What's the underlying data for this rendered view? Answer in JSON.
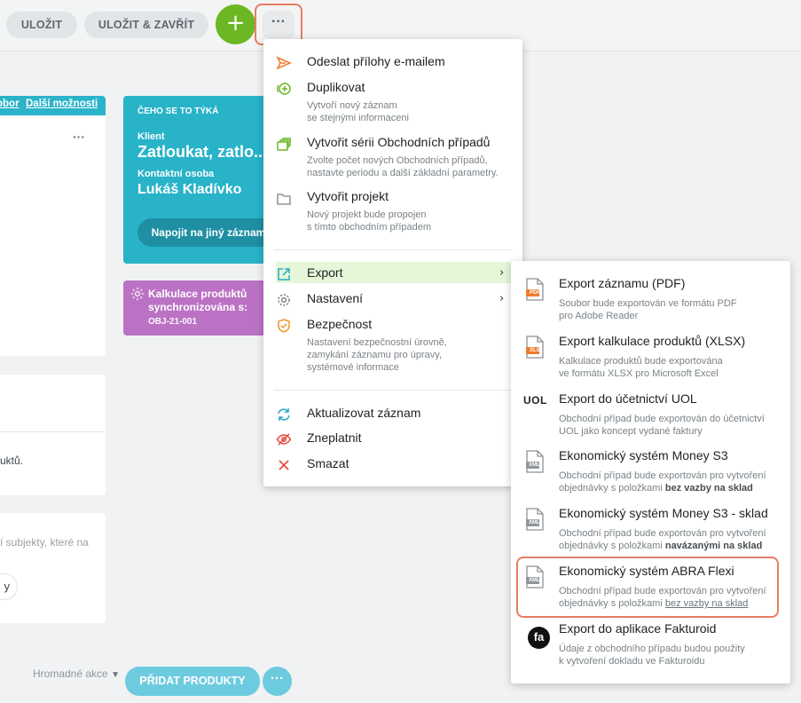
{
  "toolbar": {
    "save_label": "ULOŽIT",
    "save_close_label": "ULOŽIT & ZAVŘÍT",
    "add_label": "+",
    "more_label": "···"
  },
  "page": {
    "panel_link_a": "obor",
    "panel_link_b": "Další možnosti",
    "panel_dots": "···",
    "panel_mid_text": "uktů.",
    "panel_low_text": "í subjekty, které na",
    "panel_low_pill": "y",
    "relation_card": {
      "heading": "ČEHO SE TO TÝKÁ",
      "client_label": "Klient",
      "client_value": "Zatloukat, zatlo...",
      "contact_label": "Kontaktní osoba",
      "contact_value": "Lukáš Kladívko",
      "connect_button": "Napojit na jiný záznam"
    },
    "sync_card": {
      "title": "Kalkulace produktů synchronizována s:",
      "ref": "OBJ-21-001"
    },
    "bulk_actions": "Hromadné akce",
    "add_products": "PŘIDAT PRODUKTY",
    "more_small": "···"
  },
  "menu": {
    "items": [
      {
        "label": "Odeslat přílohy e-mailem",
        "desc": [],
        "icon": "send-icon"
      },
      {
        "label": "Duplikovat",
        "desc": [
          "Vytvoří nový záznam",
          "se stejnými informaceni"
        ],
        "icon": "duplicate-icon"
      },
      {
        "label": "Vytvořit sérii Obchodních případů",
        "desc": [
          "Zvolte počet nových Obchodních případů,",
          "nastavte periodu a další základní parametry."
        ],
        "icon": "series-icon"
      },
      {
        "label": "Vytvořit projekt",
        "desc": [
          "Nový projekt bude propojen",
          "s tímto obchodním případem"
        ],
        "icon": "folder-icon"
      },
      {
        "label": "Export",
        "desc": [],
        "icon": "export-icon"
      },
      {
        "label": "Nastavení",
        "desc": [],
        "icon": "gear-icon"
      },
      {
        "label": "Bezpečnost",
        "desc": [
          "Nastavení bezpečnostní úrovně,",
          "zamykání záznamu pro úpravy,",
          "systémové informace"
        ],
        "icon": "shield-icon"
      },
      {
        "label": "Aktualizovat záznam",
        "desc": [],
        "icon": "refresh-icon"
      },
      {
        "label": "Zneplatnit",
        "desc": [],
        "icon": "eye-off-icon"
      },
      {
        "label": "Smazat",
        "desc": [],
        "icon": "close-icon"
      }
    ]
  },
  "submenu": {
    "items": [
      {
        "label": "Export záznamu (PDF)",
        "desc1": "Soubor bude exportován ve formátu PDF",
        "desc2": "pro Adobe Reader",
        "icon": "pdf-file-icon",
        "badge": "PDF"
      },
      {
        "label": "Export kalkulace produktů (XLSX)",
        "desc1": "Kalkulace produktů bude exportována",
        "desc2": "ve formátu XLSX pro Microsoft Excel",
        "icon": "xlsx-file-icon",
        "badge": "XLS"
      },
      {
        "label": "Export do účetnictví UOL",
        "desc1": "Obchodní případ bude exportován do účetnictví",
        "desc2": "UOL jako koncept vydané faktury",
        "icon": "uol-logo-icon",
        "badge": "UOL"
      },
      {
        "label": "Ekonomický systém Money S3",
        "desc1": "Obchodní případ bude exportován pro vytvoření",
        "desc2_pre": "objednávky s položkami ",
        "desc2_em": "bez vazby na sklad",
        "icon": "xml-file-icon",
        "badge": "XML"
      },
      {
        "label": "Ekonomický systém Money S3 - sklad",
        "desc1": "Obchodní případ bude exportován pro vytvoření",
        "desc2_pre": "objednávky s položkami ",
        "desc2_em": "navázanými na sklad",
        "icon": "xml-file-icon",
        "badge": "XML"
      },
      {
        "label": "Ekonomický systém ABRA Flexi",
        "desc1": "Obchodní případ bude exportován pro vytvoření",
        "desc2_pre": "objednávky s položkami ",
        "desc2_em": "bez vazby na sklad",
        "icon": "xml-file-icon",
        "badge": "XML"
      },
      {
        "label": "Export do aplikace Fakturoid",
        "desc1": "Údaje z obchodního případu budou použity",
        "desc2": "k vytvoření dokladu ve Fakturoidu",
        "icon": "fakturoid-logo-icon",
        "badge": "fa"
      }
    ]
  },
  "colors": {
    "accent_green": "#6bb724",
    "teal": "#28b3c9",
    "purple": "#bb72c5",
    "highlight": "#e87d62",
    "export_hover": "#e5f6d9"
  }
}
